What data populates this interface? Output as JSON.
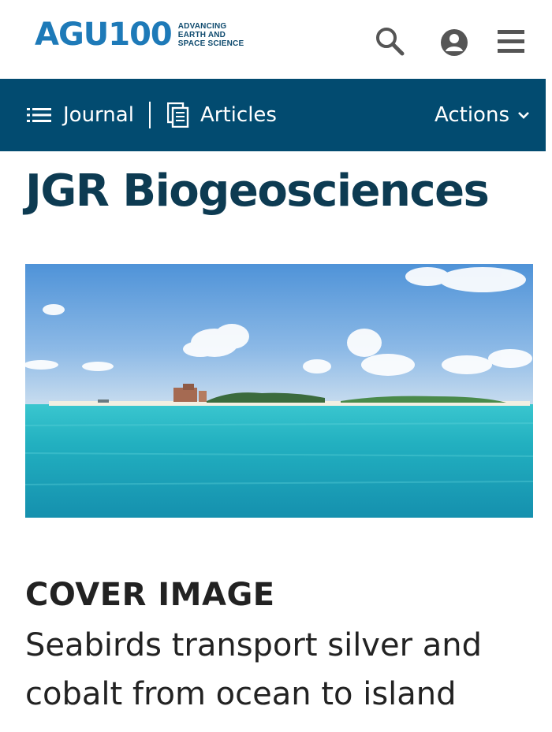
{
  "header": {
    "logo_text": "AGU100",
    "logo_tagline": [
      "ADVANCING",
      "EARTH AND",
      "SPACE SCIENCE"
    ],
    "icons": [
      "search-icon",
      "account-icon",
      "menu-icon"
    ]
  },
  "nav": {
    "journal_label": "Journal",
    "articles_label": "Articles",
    "actions_label": "Actions"
  },
  "journal_title": "JGR Biogeosciences",
  "cover": {
    "label": "COVER IMAGE",
    "description": "Seabirds transport silver and cobalt from ocean to island"
  },
  "colors": {
    "brand_blue": "#1e7ab8",
    "nav_bg": "#024b70",
    "title": "#0d3b52",
    "text": "#222222"
  }
}
